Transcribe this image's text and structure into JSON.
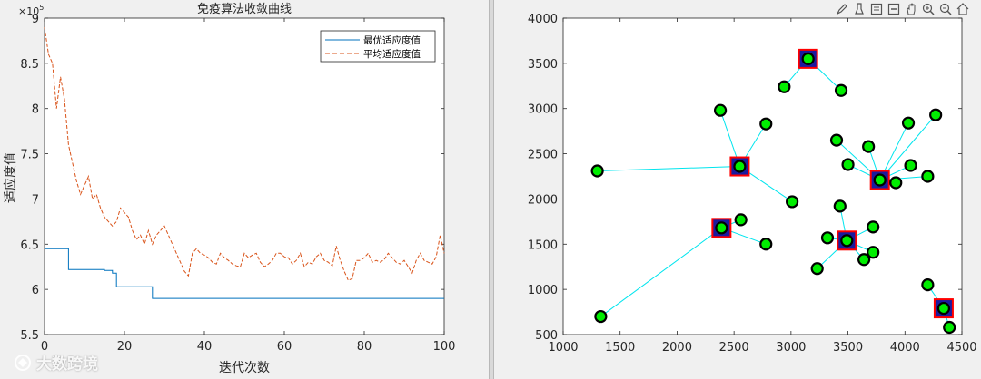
{
  "watermark": "大数跨境",
  "chart_data": [
    {
      "type": "line",
      "title": "免疫算法收敛曲线",
      "xlabel": "迭代次数",
      "ylabel": "适应度值",
      "xlim": [
        0,
        100
      ],
      "ylim": [
        550000,
        900000
      ],
      "y_exponent_label": "×10",
      "y_exponent": "5",
      "xticks": [
        0,
        20,
        40,
        60,
        80,
        100
      ],
      "yticks": [
        5.5,
        6,
        6.5,
        7,
        7.5,
        8,
        8.5,
        9
      ],
      "legend": {
        "placement": "top-right"
      },
      "series": [
        {
          "name": "最优适应度值",
          "color": "#0072bd",
          "style": "solid",
          "x": [
            0,
            6,
            6,
            15,
            15,
            17,
            17,
            18,
            18,
            27,
            27,
            100
          ],
          "y": [
            645000,
            645000,
            622000,
            622000,
            621000,
            621000,
            618000,
            618000,
            603000,
            603000,
            590000,
            590000
          ]
        },
        {
          "name": "平均适应度值",
          "color": "#d95319",
          "style": "dashed",
          "x": [
            0,
            1,
            2,
            3,
            4,
            5,
            6,
            7,
            8,
            9,
            10,
            11,
            12,
            13,
            14,
            15,
            16,
            17,
            18,
            19,
            20,
            21,
            22,
            23,
            24,
            25,
            26,
            27,
            28,
            29,
            30,
            31,
            32,
            33,
            34,
            35,
            36,
            37,
            38,
            39,
            40,
            41,
            42,
            43,
            44,
            45,
            46,
            47,
            48,
            49,
            50,
            51,
            52,
            53,
            54,
            55,
            56,
            57,
            58,
            59,
            60,
            61,
            62,
            63,
            64,
            65,
            66,
            67,
            68,
            69,
            70,
            71,
            72,
            73,
            74,
            75,
            76,
            77,
            78,
            79,
            80,
            81,
            82,
            83,
            84,
            85,
            86,
            87,
            88,
            89,
            90,
            91,
            92,
            93,
            94,
            95,
            96,
            97,
            98,
            99,
            100
          ],
          "y": [
            890000,
            860000,
            850000,
            800000,
            835000,
            810000,
            760000,
            740000,
            720000,
            705000,
            715000,
            725000,
            700000,
            705000,
            690000,
            680000,
            675000,
            670000,
            675000,
            690000,
            685000,
            680000,
            665000,
            655000,
            660000,
            650000,
            665000,
            650000,
            660000,
            665000,
            670000,
            660000,
            650000,
            640000,
            630000,
            620000,
            615000,
            640000,
            645000,
            640000,
            638000,
            635000,
            630000,
            628000,
            640000,
            635000,
            632000,
            628000,
            626000,
            625000,
            640000,
            635000,
            638000,
            640000,
            630000,
            625000,
            628000,
            632000,
            640000,
            640000,
            636000,
            635000,
            628000,
            632000,
            640000,
            625000,
            630000,
            628000,
            636000,
            640000,
            632000,
            630000,
            626000,
            648000,
            632000,
            620000,
            610000,
            612000,
            632000,
            632000,
            635000,
            640000,
            630000,
            632000,
            630000,
            633000,
            640000,
            635000,
            630000,
            628000,
            632000,
            625000,
            618000,
            632000,
            640000,
            632000,
            630000,
            628000,
            636000,
            660000,
            640000
          ]
        }
      ]
    },
    {
      "type": "scatter",
      "title": "",
      "xlabel": "",
      "ylabel": "",
      "xlim": [
        1000,
        4500
      ],
      "ylim": [
        500,
        4000
      ],
      "xticks": [
        1000,
        1500,
        2000,
        2500,
        3000,
        3500,
        4000,
        4500
      ],
      "yticks": [
        500,
        1000,
        1500,
        2000,
        2500,
        3000,
        3500,
        4000
      ],
      "link_color": "#00e5ee",
      "point_fill": "#00ee00",
      "point_edge": "#000000",
      "center_square_fill": "#1a1a9e",
      "center_square_edge": "#ff0000",
      "centers": [
        {
          "x": 3150,
          "y": 3550
        },
        {
          "x": 2550,
          "y": 2360
        },
        {
          "x": 3780,
          "y": 2210
        },
        {
          "x": 2390,
          "y": 1680
        },
        {
          "x": 3490,
          "y": 1540
        },
        {
          "x": 4340,
          "y": 790
        }
      ],
      "points": [
        {
          "x": 3150,
          "y": 3550,
          "c": 0
        },
        {
          "x": 2940,
          "y": 3240,
          "c": 0
        },
        {
          "x": 3440,
          "y": 3200,
          "c": 0
        },
        {
          "x": 2550,
          "y": 2360,
          "c": 1
        },
        {
          "x": 2380,
          "y": 2980,
          "c": 1
        },
        {
          "x": 2780,
          "y": 2830,
          "c": 1
        },
        {
          "x": 1300,
          "y": 2310,
          "c": 1
        },
        {
          "x": 3010,
          "y": 1970,
          "c": 1
        },
        {
          "x": 3780,
          "y": 2210,
          "c": 2
        },
        {
          "x": 3400,
          "y": 2650,
          "c": 2
        },
        {
          "x": 3680,
          "y": 2580,
          "c": 2
        },
        {
          "x": 4030,
          "y": 2840,
          "c": 2
        },
        {
          "x": 4270,
          "y": 2930,
          "c": 2
        },
        {
          "x": 3500,
          "y": 2380,
          "c": 2
        },
        {
          "x": 4050,
          "y": 2370,
          "c": 2
        },
        {
          "x": 4200,
          "y": 2250,
          "c": 2
        },
        {
          "x": 3920,
          "y": 2180,
          "c": 2
        },
        {
          "x": 2390,
          "y": 1680,
          "c": 3
        },
        {
          "x": 2560,
          "y": 1770,
          "c": 3
        },
        {
          "x": 2780,
          "y": 1500,
          "c": 3
        },
        {
          "x": 1330,
          "y": 700,
          "c": 3
        },
        {
          "x": 3490,
          "y": 1540,
          "c": 4
        },
        {
          "x": 3430,
          "y": 1920,
          "c": 4
        },
        {
          "x": 3720,
          "y": 1690,
          "c": 4
        },
        {
          "x": 3320,
          "y": 1570,
          "c": 4
        },
        {
          "x": 3720,
          "y": 1410,
          "c": 4
        },
        {
          "x": 3640,
          "y": 1330,
          "c": 4
        },
        {
          "x": 3230,
          "y": 1230,
          "c": 4
        },
        {
          "x": 4340,
          "y": 790,
          "c": 5
        },
        {
          "x": 4200,
          "y": 1050,
          "c": 5
        },
        {
          "x": 4390,
          "y": 580,
          "c": 5
        }
      ]
    }
  ]
}
